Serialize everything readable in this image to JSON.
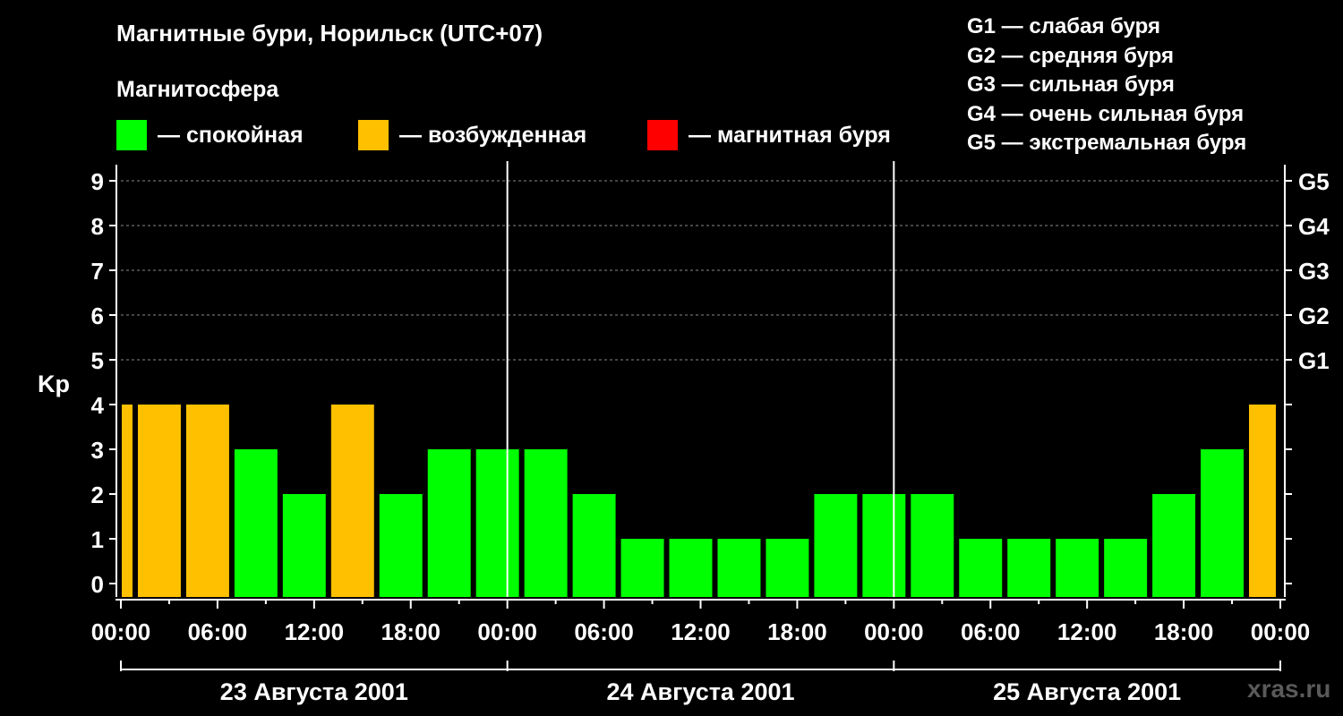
{
  "title": "Магнитные бури, Норильск (UTC+07)",
  "subtitle": "Магнитосфера",
  "legend": [
    {
      "label": "— спокойная",
      "color": "#00ff00"
    },
    {
      "label": "— возбужденная",
      "color": "#ffc000"
    },
    {
      "label": "— магнитная буря",
      "color": "#ff0000"
    }
  ],
  "storm_levels": [
    "G1 — слабая буря",
    "G2 — средняя буря",
    "G3 — сильная буря",
    "G4 — очень сильная буря",
    "G5 — экстремальная буря"
  ],
  "watermark": "xras.ru",
  "chart_data": {
    "type": "bar",
    "ylabel": "Kp",
    "ylim": [
      0,
      9
    ],
    "yticks": [
      0,
      1,
      2,
      3,
      4,
      5,
      6,
      7,
      8,
      9
    ],
    "right_axis": [
      {
        "kp": 5,
        "label": "G1"
      },
      {
        "kp": 6,
        "label": "G2"
      },
      {
        "kp": 7,
        "label": "G3"
      },
      {
        "kp": 8,
        "label": "G4"
      },
      {
        "kp": 9,
        "label": "G5"
      }
    ],
    "grid": "horizontal dashed",
    "x_start_hour": 0,
    "x_end_hour": 72,
    "xticks": [
      "00:00",
      "06:00",
      "12:00",
      "18:00",
      "00:00",
      "06:00",
      "12:00",
      "18:00",
      "00:00",
      "06:00",
      "12:00",
      "18:00",
      "00:00"
    ],
    "days": [
      "23 Августа 2001",
      "24 Августа 2001",
      "25 Августа 2001"
    ],
    "bars": [
      {
        "start": 0,
        "end": 1,
        "kp": 4,
        "color": "#ffc000"
      },
      {
        "start": 1,
        "end": 4,
        "kp": 4,
        "color": "#ffc000"
      },
      {
        "start": 4,
        "end": 7,
        "kp": 4,
        "color": "#ffc000"
      },
      {
        "start": 7,
        "end": 10,
        "kp": 3,
        "color": "#00ff00"
      },
      {
        "start": 10,
        "end": 13,
        "kp": 2,
        "color": "#00ff00"
      },
      {
        "start": 13,
        "end": 16,
        "kp": 4,
        "color": "#ffc000"
      },
      {
        "start": 16,
        "end": 19,
        "kp": 2,
        "color": "#00ff00"
      },
      {
        "start": 19,
        "end": 22,
        "kp": 3,
        "color": "#00ff00"
      },
      {
        "start": 22,
        "end": 25,
        "kp": 3,
        "color": "#00ff00"
      },
      {
        "start": 25,
        "end": 28,
        "kp": 3,
        "color": "#00ff00"
      },
      {
        "start": 28,
        "end": 31,
        "kp": 2,
        "color": "#00ff00"
      },
      {
        "start": 31,
        "end": 34,
        "kp": 1,
        "color": "#00ff00"
      },
      {
        "start": 34,
        "end": 37,
        "kp": 1,
        "color": "#00ff00"
      },
      {
        "start": 37,
        "end": 40,
        "kp": 1,
        "color": "#00ff00"
      },
      {
        "start": 40,
        "end": 43,
        "kp": 1,
        "color": "#00ff00"
      },
      {
        "start": 43,
        "end": 46,
        "kp": 2,
        "color": "#00ff00"
      },
      {
        "start": 46,
        "end": 49,
        "kp": 2,
        "color": "#00ff00"
      },
      {
        "start": 49,
        "end": 52,
        "kp": 2,
        "color": "#00ff00"
      },
      {
        "start": 52,
        "end": 55,
        "kp": 1,
        "color": "#00ff00"
      },
      {
        "start": 55,
        "end": 58,
        "kp": 1,
        "color": "#00ff00"
      },
      {
        "start": 58,
        "end": 61,
        "kp": 1,
        "color": "#00ff00"
      },
      {
        "start": 61,
        "end": 64,
        "kp": 1,
        "color": "#00ff00"
      },
      {
        "start": 64,
        "end": 67,
        "kp": 2,
        "color": "#00ff00"
      },
      {
        "start": 67,
        "end": 70,
        "kp": 3,
        "color": "#00ff00"
      },
      {
        "start": 70,
        "end": 72,
        "kp": 4,
        "color": "#ffc000"
      }
    ]
  }
}
